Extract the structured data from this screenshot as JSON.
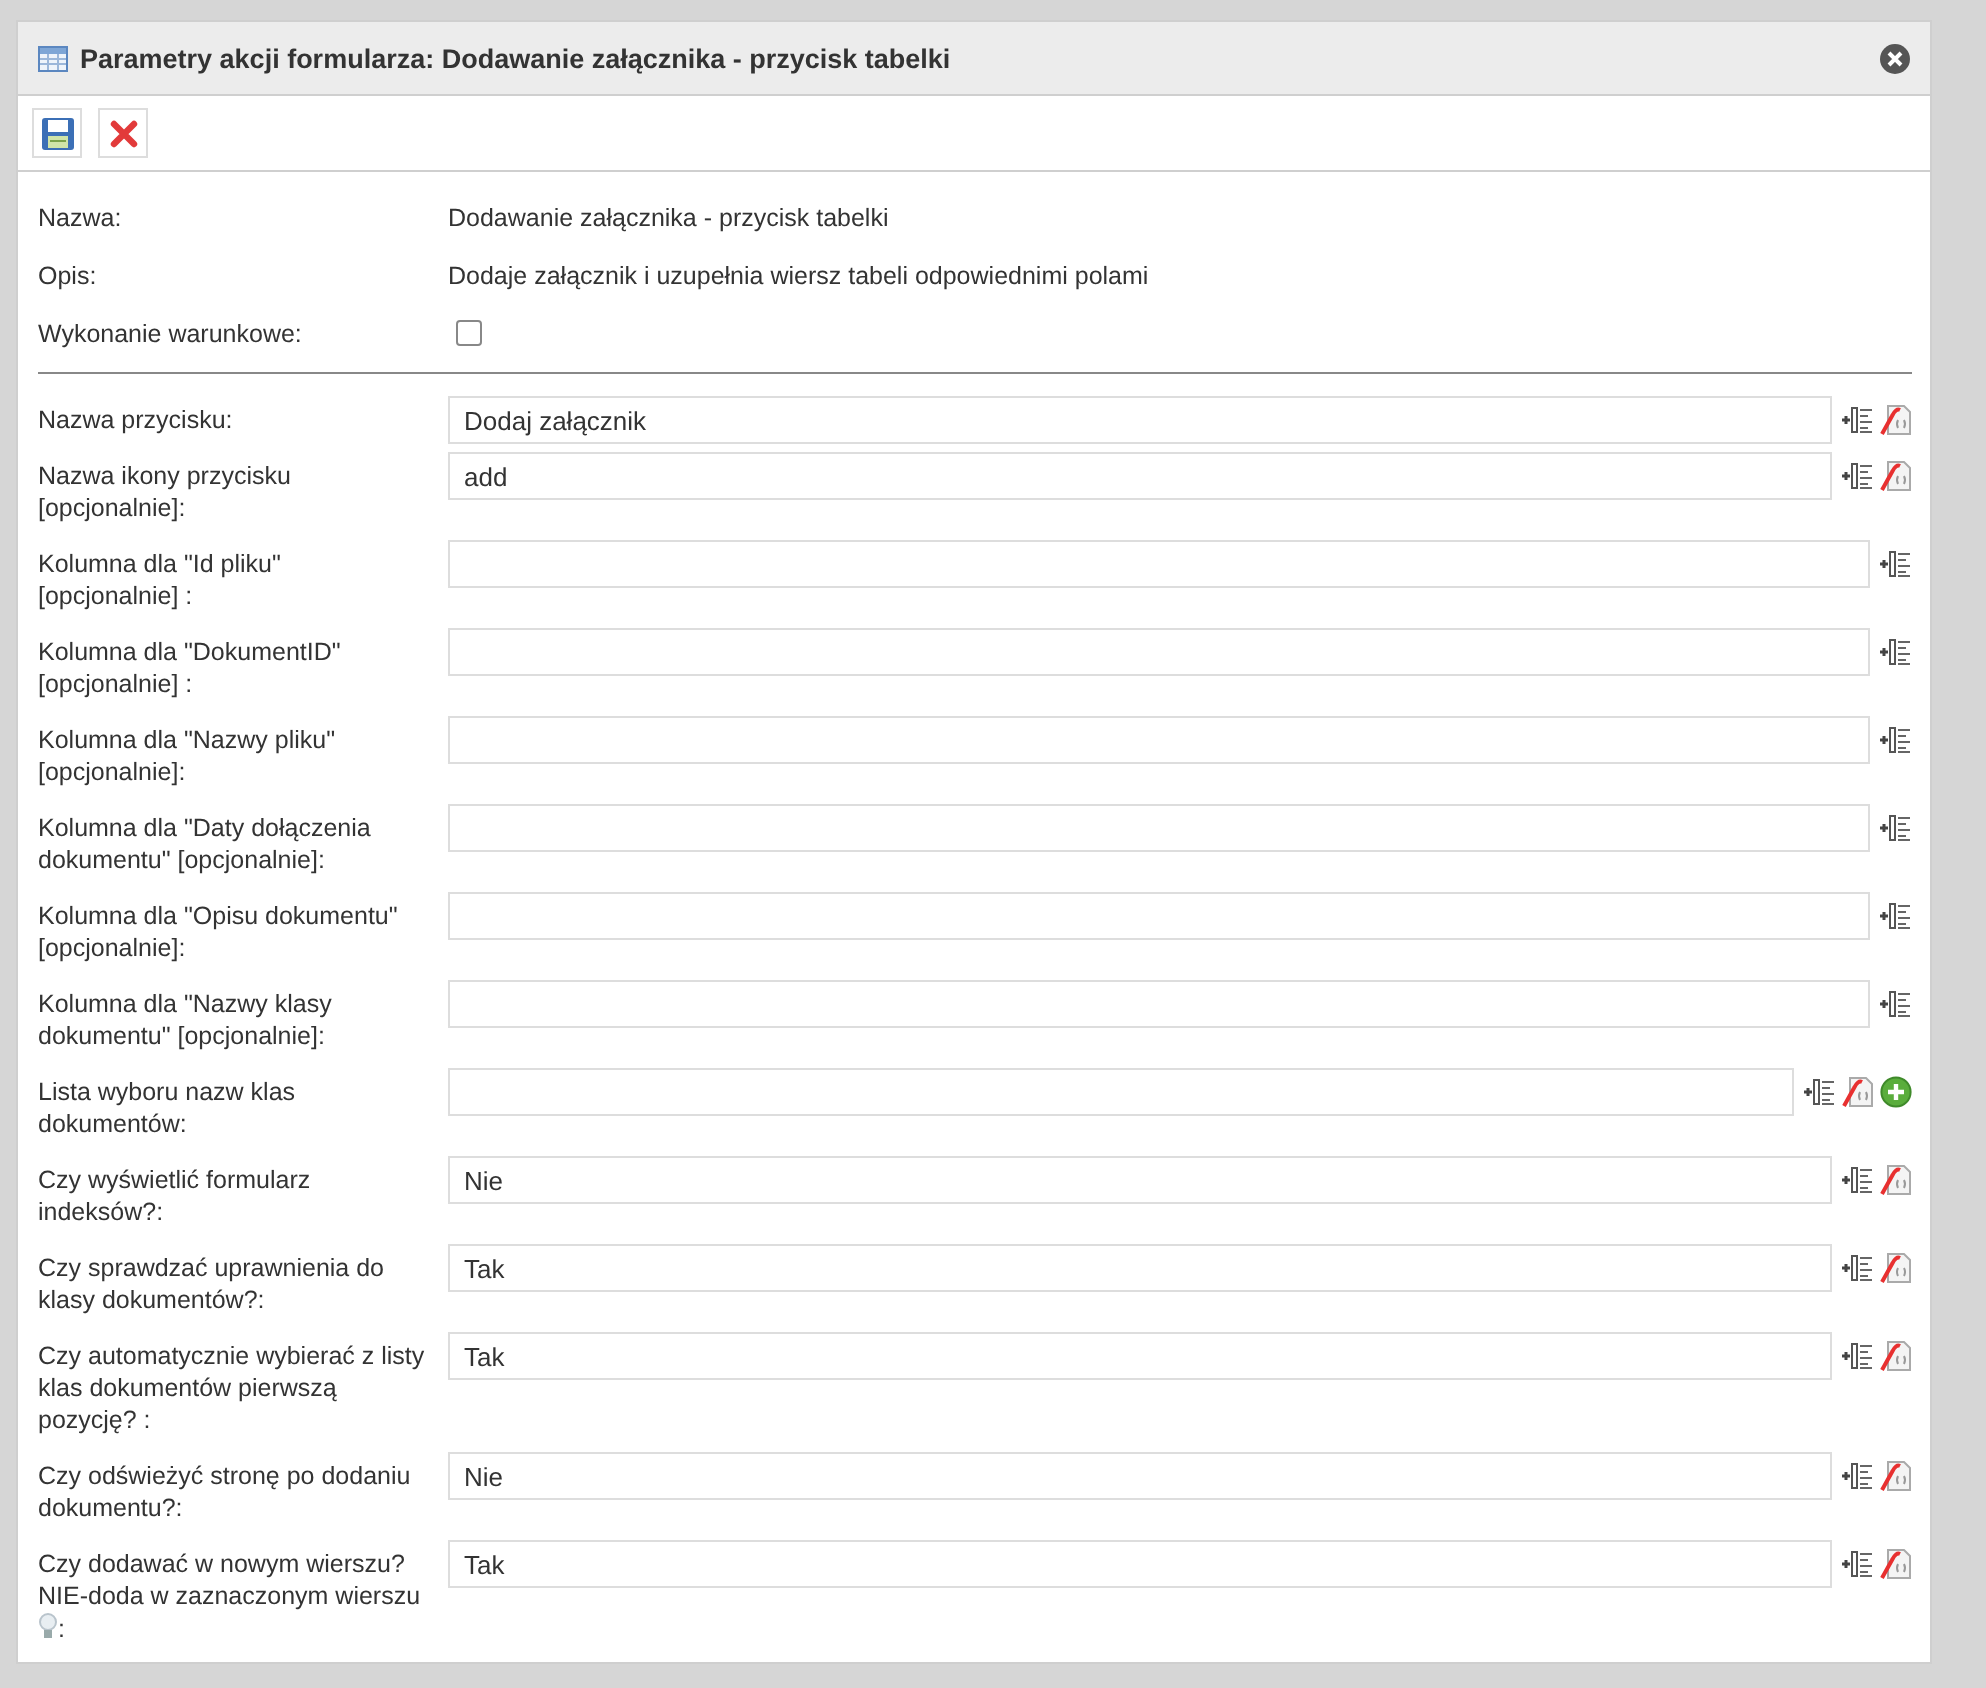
{
  "dialog": {
    "title": "Parametry akcji formularza: Dodawanie załącznika - przycisk tabelki"
  },
  "toolbar": [
    {
      "kind": "save"
    },
    {
      "kind": "cancel"
    }
  ],
  "info": [
    {
      "label": "Nazwa:",
      "kind": "text",
      "value": "Dodawanie załącznika - przycisk tabelki"
    },
    {
      "label": "Opis:",
      "kind": "text",
      "value": "Dodaje załącznik i uzupełnia wiersz tabeli odpowiednimi polami"
    },
    {
      "label": "Wykonanie warunkowe:",
      "kind": "checkbox",
      "checked": false
    }
  ],
  "fields": [
    {
      "label": "Nazwa przycisku:",
      "value": "Dodaj załącznik",
      "icons": [
        {
          "kind": "variable"
        },
        {
          "kind": "script"
        }
      ]
    },
    {
      "label": "Nazwa ikony przycisku [opcjonalnie]:",
      "value": "add",
      "icons": [
        {
          "kind": "variable"
        },
        {
          "kind": "script"
        }
      ]
    },
    {
      "label": "Kolumna dla \"Id pliku\" [opcjonalnie] :",
      "icons": [
        {
          "kind": "variable"
        }
      ]
    },
    {
      "label": "Kolumna dla \"DokumentID\" [opcjonalnie] :",
      "icons": [
        {
          "kind": "variable"
        }
      ]
    },
    {
      "label": "Kolumna dla \"Nazwy pliku\" [opcjonalnie]:",
      "icons": [
        {
          "kind": "variable"
        }
      ]
    },
    {
      "label": "Kolumna dla \"Daty dołączenia dokumentu\" [opcjonalnie]:",
      "icons": [
        {
          "kind": "variable"
        }
      ]
    },
    {
      "label": "Kolumna dla \"Opisu dokumentu\" [opcjonalnie]:",
      "icons": [
        {
          "kind": "variable"
        }
      ]
    },
    {
      "label": "Kolumna dla \"Nazwy klasy dokumentu\" [opcjonalnie]:",
      "icons": [
        {
          "kind": "variable"
        }
      ]
    },
    {
      "label": "Lista wyboru nazw klas dokumentów:",
      "icons": [
        {
          "kind": "variable"
        },
        {
          "kind": "script"
        },
        {
          "kind": "add"
        }
      ]
    },
    {
      "label": "Czy wyświetlić formularz indeksów?:",
      "value": "Nie",
      "icons": [
        {
          "kind": "variable"
        },
        {
          "kind": "script"
        }
      ]
    },
    {
      "label": "Czy sprawdzać uprawnienia do klasy dokumentów?:",
      "value": "Tak",
      "icons": [
        {
          "kind": "variable"
        },
        {
          "kind": "script"
        }
      ]
    },
    {
      "label": "Czy automatycznie wybierać z listy klas dokumentów pierwszą pozycję? :",
      "value": "Tak",
      "icons": [
        {
          "kind": "variable"
        },
        {
          "kind": "script"
        }
      ]
    },
    {
      "label": "Czy odświeżyć stronę po dodaniu dokumentu?:",
      "value": "Nie",
      "icons": [
        {
          "kind": "variable"
        },
        {
          "kind": "script"
        }
      ]
    },
    {
      "label": "Czy dodawać w nowym wierszu? NIE-doda w zaznaczonym wierszu",
      "hint": true,
      "label_suffix": ":",
      "value": "Tak",
      "icons": [
        {
          "kind": "variable"
        },
        {
          "kind": "script"
        }
      ]
    }
  ]
}
